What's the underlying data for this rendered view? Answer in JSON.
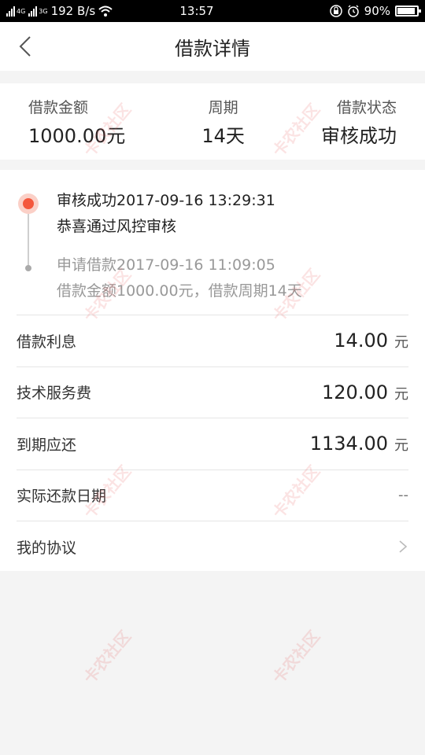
{
  "status_bar": {
    "network_1": "4G",
    "network_2": "3G",
    "speed": "192 B/s",
    "time": "13:57",
    "battery": "90%"
  },
  "nav": {
    "title": "借款详情"
  },
  "summary": {
    "amount_label": "借款金额",
    "amount_value": "1000.00元",
    "period_label": "周期",
    "period_value": "14天",
    "status_label": "借款状态",
    "status_value": "审核成功"
  },
  "timeline": [
    {
      "title": "审核成功2017-09-16 13:29:31",
      "desc": "恭喜通过风控审核"
    },
    {
      "title": "申请借款2017-09-16 11:09:05",
      "desc": "借款金额1000.00元，借款周期14天"
    }
  ],
  "rows": {
    "interest": {
      "label": "借款利息",
      "value": "14.00",
      "unit": "元"
    },
    "service_fee": {
      "label": "技术服务费",
      "value": "120.00",
      "unit": "元"
    },
    "due": {
      "label": "到期应还",
      "value": "1134.00",
      "unit": "元"
    },
    "actual_date": {
      "label": "实际还款日期",
      "value": "--"
    },
    "agreement": {
      "label": "我的协议"
    }
  },
  "watermark": "卡农社区",
  "colors": {
    "accent": "#f4573c",
    "background": "#f4f4f4"
  }
}
